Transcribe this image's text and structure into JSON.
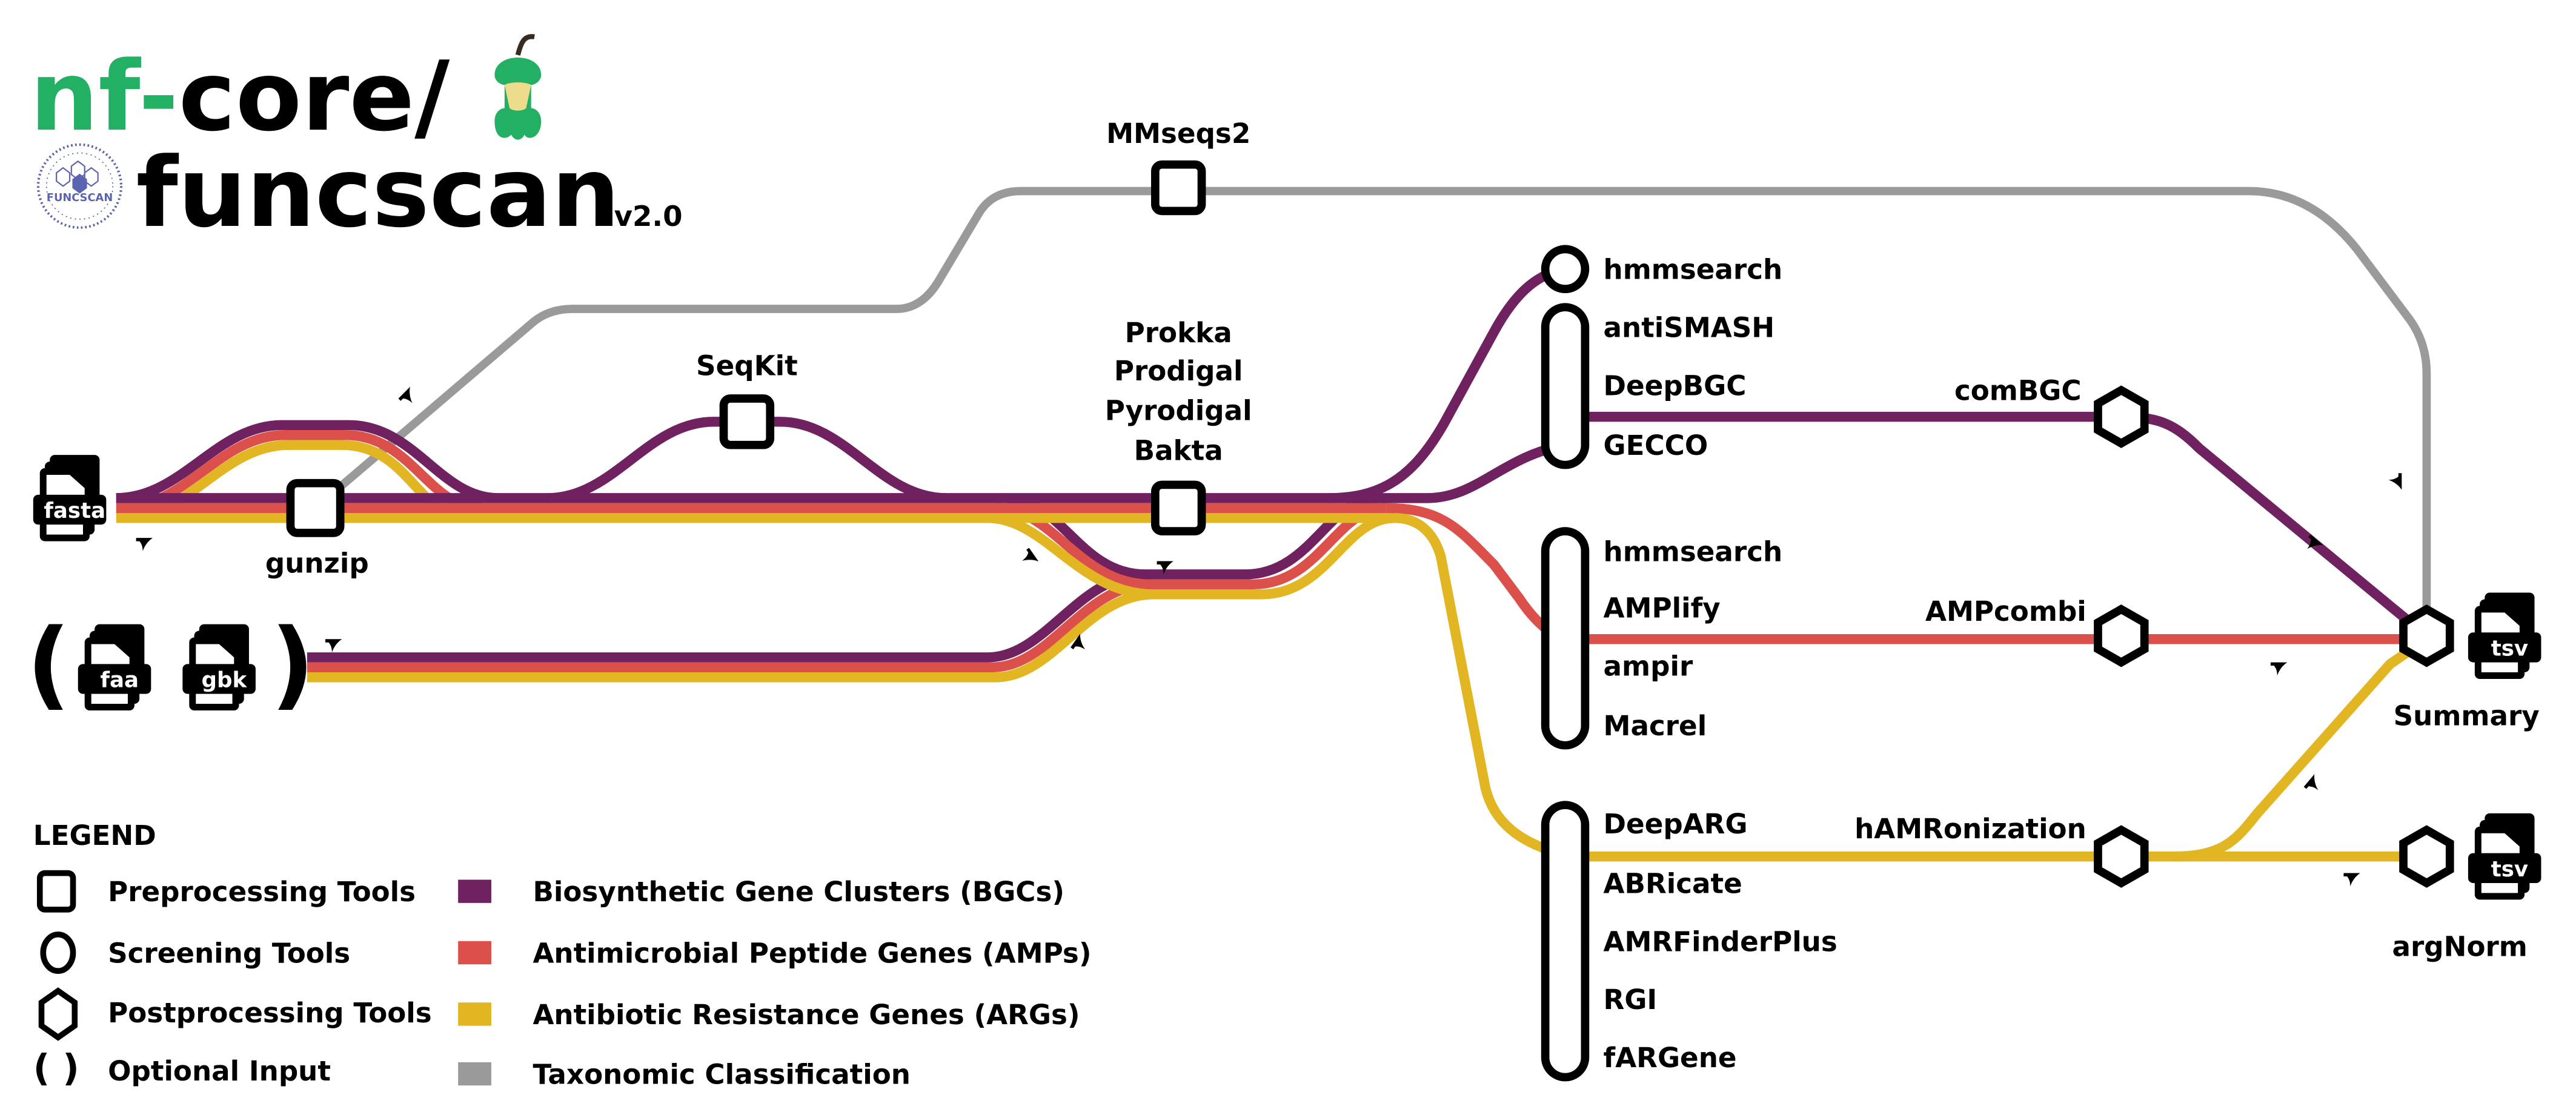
{
  "header": {
    "brand_prefix": "nf-",
    "brand_core": "core/",
    "pipeline_name": "funcscan",
    "version": "v2.0",
    "badge_text": "FUNCSCAN",
    "colors": {
      "brand_green": "#24B064",
      "apple_core": "#ECDC8C",
      "badge_blue": "#5B64B0"
    }
  },
  "inputs": {
    "main": "fasta",
    "optional": [
      "faa",
      "gbk"
    ],
    "optional_open": "(",
    "optional_close": ")"
  },
  "preprocessing": {
    "gunzip": "gunzip",
    "seqkit": "SeqKit",
    "mmseqs": "MMseqs2",
    "annotation": [
      "Prokka",
      "Prodigal",
      "Pyrodigal",
      "Bakta"
    ]
  },
  "screening": {
    "bgc": [
      "hmmsearch",
      "antiSMASH",
      "DeepBGC",
      "GECCO"
    ],
    "amp": [
      "hmmsearch",
      "AMPlify",
      "ampir",
      "Macrel"
    ],
    "arg": [
      "DeepARG",
      "ABRicate",
      "AMRFinderPlus",
      "RGI",
      "fARGene"
    ]
  },
  "postprocessing": {
    "bgc": "comBGC",
    "amp": "AMPcombi",
    "arg": "hAMRonization",
    "summary": "Summary",
    "argnorm": "argNorm",
    "output_format": "tsv"
  },
  "legend": {
    "title": "LEGEND",
    "shapes": [
      {
        "icon": "square-icon",
        "label": "Preprocessing Tools"
      },
      {
        "icon": "circle-icon",
        "label": "Screening Tools"
      },
      {
        "icon": "hexagon-icon",
        "label": "Postprocessing Tools"
      },
      {
        "icon": "parentheses-icon",
        "label": "Optional Input"
      }
    ],
    "tracks": [
      {
        "label": "Biosynthetic Gene Clusters (BGCs)",
        "color": "#70215F"
      },
      {
        "label": "Antimicrobial Peptide Genes (AMPs)",
        "color": "#DB504A"
      },
      {
        "label": "Antibiotic Resistance Genes (ARGs)",
        "color": "#E2B522"
      },
      {
        "label": "Taxonomic Classification",
        "color": "#9A9A9A"
      }
    ]
  }
}
